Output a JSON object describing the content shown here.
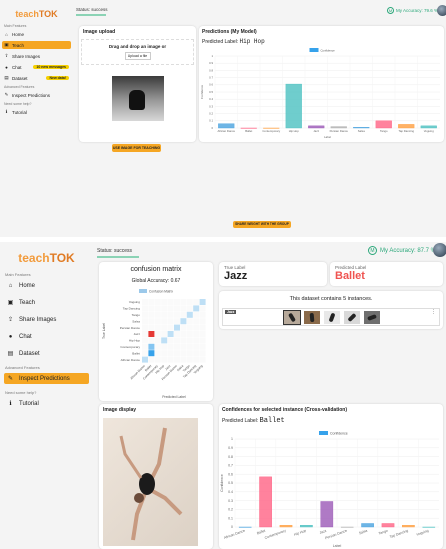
{
  "top": {
    "logo": {
      "part1": "teach",
      "part2": "TOK"
    },
    "status": "Status: success",
    "accuracy": "My Accuracy: 79.6 %",
    "sidebar": {
      "main_label": "Main Features",
      "items": [
        {
          "label": "Home",
          "icon": "home-icon",
          "glyph": "⌂"
        },
        {
          "label": "Teach",
          "icon": "teach-icon",
          "glyph": "▣",
          "active": true
        },
        {
          "label": "Share Images",
          "icon": "upload-icon",
          "glyph": "⇪"
        },
        {
          "label": "Chat",
          "icon": "chat-icon",
          "glyph": "●",
          "badge": "10 new messages"
        },
        {
          "label": "Dataset",
          "icon": "dataset-icon",
          "glyph": "▤",
          "badge": "New data!"
        }
      ],
      "advanced_label": "Advanced Features",
      "advanced_items": [
        {
          "label": "Inspect Predictions",
          "icon": "pencil-icon",
          "glyph": "✎"
        }
      ],
      "help_label": "Need some help?",
      "help_items": [
        {
          "label": "Tutorial",
          "icon": "info-icon",
          "glyph": "ℹ"
        }
      ]
    },
    "upload": {
      "title": "Image upload",
      "drop_text": "Drag and drop an image or",
      "button": "Upload a file",
      "use_button": "USE IMAGE FOR TEACHING"
    },
    "predictions": {
      "title": "Predictions (My Model)",
      "predicted_prefix": "Predicted Label:",
      "predicted_value": "Hip Hop",
      "share_button": "SHARE WEIGHT WITH THE GROUP"
    }
  },
  "bottom": {
    "logo": {
      "part1": "teach",
      "part2": "TOK"
    },
    "status": "Status: success",
    "accuracy": "My Accuracy: 87.7 %",
    "sidebar": {
      "main_label": "Main Features",
      "items": [
        {
          "label": "Home",
          "icon": "home-icon",
          "glyph": "⌂"
        },
        {
          "label": "Teach",
          "icon": "teach-icon",
          "glyph": "▣"
        },
        {
          "label": "Share Images",
          "icon": "upload-icon",
          "glyph": "⇪"
        },
        {
          "label": "Chat",
          "icon": "chat-icon",
          "glyph": "●"
        },
        {
          "label": "Dataset",
          "icon": "dataset-icon",
          "glyph": "▤"
        }
      ],
      "advanced_label": "Advanced Features",
      "advanced_items": [
        {
          "label": "Inspect Predictions",
          "icon": "pencil-icon",
          "glyph": "✎",
          "active": true
        }
      ],
      "help_label": "Need some help?",
      "help_items": [
        {
          "label": "Tutorial",
          "icon": "info-icon",
          "glyph": "ℹ"
        }
      ]
    },
    "confusion": {
      "title": "confusion matrix",
      "global_accuracy": "Global Accuracy: 0.67",
      "legend": "Confusion Matrix",
      "ylabel": "True Label",
      "xlabel": "Predicted Label"
    },
    "true_label": {
      "title": "True Label",
      "value": "Jazz"
    },
    "predicted_label": {
      "title": "Predicted Label",
      "value": "Ballet"
    },
    "instances": {
      "text": "This dataset contains 5 instances.",
      "tag": "Jazz",
      "menu": "⋮"
    },
    "image_display": {
      "title": "Image display"
    },
    "confidences": {
      "title": "Confidences for selected instance (Cross-validation)",
      "predicted_prefix": "Predicted Label:",
      "predicted_value": "Ballet"
    }
  },
  "chart_data": [
    {
      "type": "bar",
      "title": "",
      "legend": "Confidence",
      "xlabel": "Label",
      "ylabel": "Confidence",
      "ylim": [
        0,
        1.0
      ],
      "yticks": [
        0,
        0.1,
        0.2,
        0.3,
        0.4,
        0.5,
        0.6,
        0.7,
        0.8,
        0.9,
        1.0
      ],
      "categories": [
        "African Dance",
        "Ballet",
        "Contemporary",
        "Hip Hop",
        "Jazz",
        "Persian Dance",
        "Salsa",
        "Tango",
        "Tap Dancing",
        "Voguing"
      ],
      "values": [
        0.06,
        0.0,
        0.0,
        0.61,
        0.03,
        0.02,
        0.01,
        0.1,
        0.05,
        0.03
      ],
      "colors": [
        "#4aa3df",
        "#ff6384",
        "#ff9f40",
        "#4bc0c0",
        "#9b59b6",
        "#b0b0b0",
        "#4aa3df",
        "#ff6384",
        "#ff9f40",
        "#4bc0c0"
      ]
    },
    {
      "type": "heatmap",
      "title": "Global Accuracy: 0.67",
      "legend": "Confusion Matrix",
      "xlabel": "Predicted Label",
      "ylabel": "True Label",
      "labels": [
        "African Dance",
        "Ballet",
        "Contemporary",
        "Hip Hop",
        "Jazz",
        "Persian Dance",
        "Salsa",
        "Tango",
        "Tap Dancing",
        "Voguing"
      ],
      "cells": [
        {
          "true": "African Dance",
          "pred": "African Dance",
          "v": 0.3
        },
        {
          "true": "Ballet",
          "pred": "Ballet",
          "v": 1
        },
        {
          "true": "Contemporary",
          "pred": "Ballet",
          "v": 0.6
        },
        {
          "true": "Hip Hop",
          "pred": "Hip Hop",
          "v": 0.3
        },
        {
          "true": "Jazz",
          "pred": "Ballet",
          "v": 1,
          "highlight": true
        },
        {
          "true": "Jazz",
          "pred": "Jazz",
          "v": 0.3
        },
        {
          "true": "Persian Dance",
          "pred": "Persian Dance",
          "v": 0.3
        },
        {
          "true": "Salsa",
          "pred": "Salsa",
          "v": 0.3
        },
        {
          "true": "Tango",
          "pred": "Tango",
          "v": 0.3
        },
        {
          "true": "Tap Dancing",
          "pred": "Tap Dancing",
          "v": 0.3
        },
        {
          "true": "Voguing",
          "pred": "Voguing",
          "v": 0.3
        }
      ]
    },
    {
      "type": "bar",
      "title": "",
      "legend": "Confidence",
      "xlabel": "Label",
      "ylabel": "Confidence",
      "ylim": [
        0,
        1.0
      ],
      "yticks": [
        0,
        0.1,
        0.2,
        0.3,
        0.4,
        0.5,
        0.6,
        0.7,
        0.8,
        0.9,
        1.0
      ],
      "categories": [
        "African Dance",
        "Ballet",
        "Contemporary",
        "Hip Hop",
        "Jazz",
        "Persian Dance",
        "Salsa",
        "Tango",
        "Tap Dancing",
        "Voguing"
      ],
      "values": [
        0.0,
        0.57,
        0.02,
        0.02,
        0.29,
        0.0,
        0.04,
        0.04,
        0.02,
        0.0
      ],
      "colors": [
        "#4aa3df",
        "#ff6384",
        "#ff9f40",
        "#4bc0c0",
        "#9b59b6",
        "#b0b0b0",
        "#4aa3df",
        "#ff6384",
        "#ff9f40",
        "#4bc0c0"
      ]
    }
  ]
}
